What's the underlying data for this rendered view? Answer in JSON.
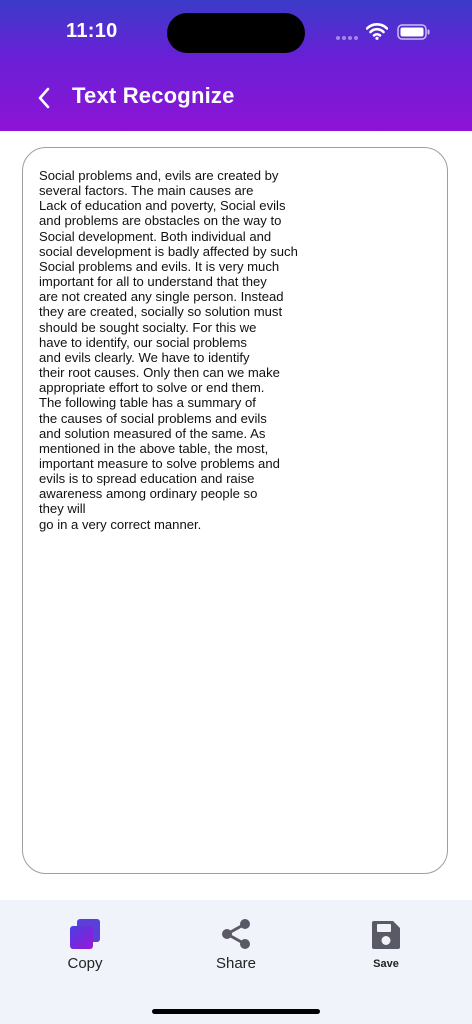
{
  "status_bar": {
    "time": "11:10"
  },
  "header": {
    "title": "Text Recognize",
    "gradient_colors": [
      "#3b3bc9",
      "#8e14d6"
    ],
    "back_icon": "chevron-left-icon"
  },
  "recognized_text": "Social problems and, evils are created by\nseveral factors. The main causes are\nLack of education and poverty, Social evils\nand problems are obstacles on the way to\nSocial development. Both individual and\nsocial development is badly affected by such\nSocial problems and evils. It is very much\nimportant for all to understand that they\nare not created any single person. Instead\nthey are created, socially so solution must\nshould be sought socialty. For this we\nhave to identify, our social problems\nand evils clearly. We have to identify\ntheir root causes. Only then can we make\nappropriate effort to solve or end them.\nThe following table has a summary of\nthe causes of social problems and evils\nand solution measured of the same. As\nmentioned in the above table, the most,\nimportant measure to solve problems and\nevils is to spread education and raise\nawareness among ordinary people so\nthey will\ngo in a very correct manner.",
  "actions": {
    "copy": {
      "label": "Copy",
      "icon": "copy-icon"
    },
    "share": {
      "label": "Share",
      "icon": "share-icon"
    },
    "save": {
      "label": "Save",
      "icon": "floppy-disk-icon"
    }
  },
  "colors": {
    "accent": "#7b1fd8",
    "icon_gray": "#5a5a66"
  }
}
